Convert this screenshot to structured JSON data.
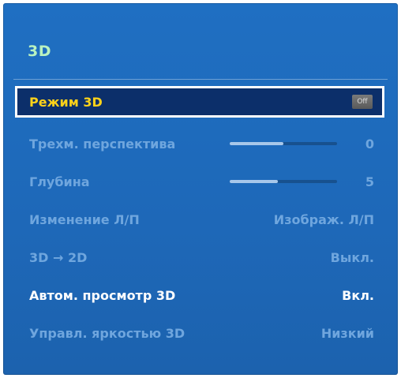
{
  "menu": {
    "title": "3D",
    "items": [
      {
        "label": "Режим 3D",
        "value": "Off",
        "kind": "toggle",
        "state": "selected"
      },
      {
        "label": "Трехм. перспектива",
        "value": "0",
        "kind": "slider",
        "level": 0.5,
        "state": "dim"
      },
      {
        "label": "Глубина",
        "value": "5",
        "kind": "slider",
        "level": 0.45,
        "state": "dim"
      },
      {
        "label": "Изменение Л/П",
        "value": "Изображ. Л/П",
        "kind": "option",
        "state": "dim"
      },
      {
        "label": "3D → 2D",
        "value": "Выкл.",
        "kind": "option",
        "state": "dim"
      },
      {
        "label": "Автом. просмотр 3D",
        "value": "Вкл.",
        "kind": "option",
        "state": "bright"
      },
      {
        "label": "Управл. яркостью 3D",
        "value": "Низкий",
        "kind": "option",
        "state": "dim"
      }
    ]
  },
  "colors": {
    "panel": "#1f6fc2",
    "title": "#b9f2c0",
    "selected_bg": "#0c2f6a",
    "selected_label": "#ffd21a",
    "dim_text": "#6fa6de"
  }
}
